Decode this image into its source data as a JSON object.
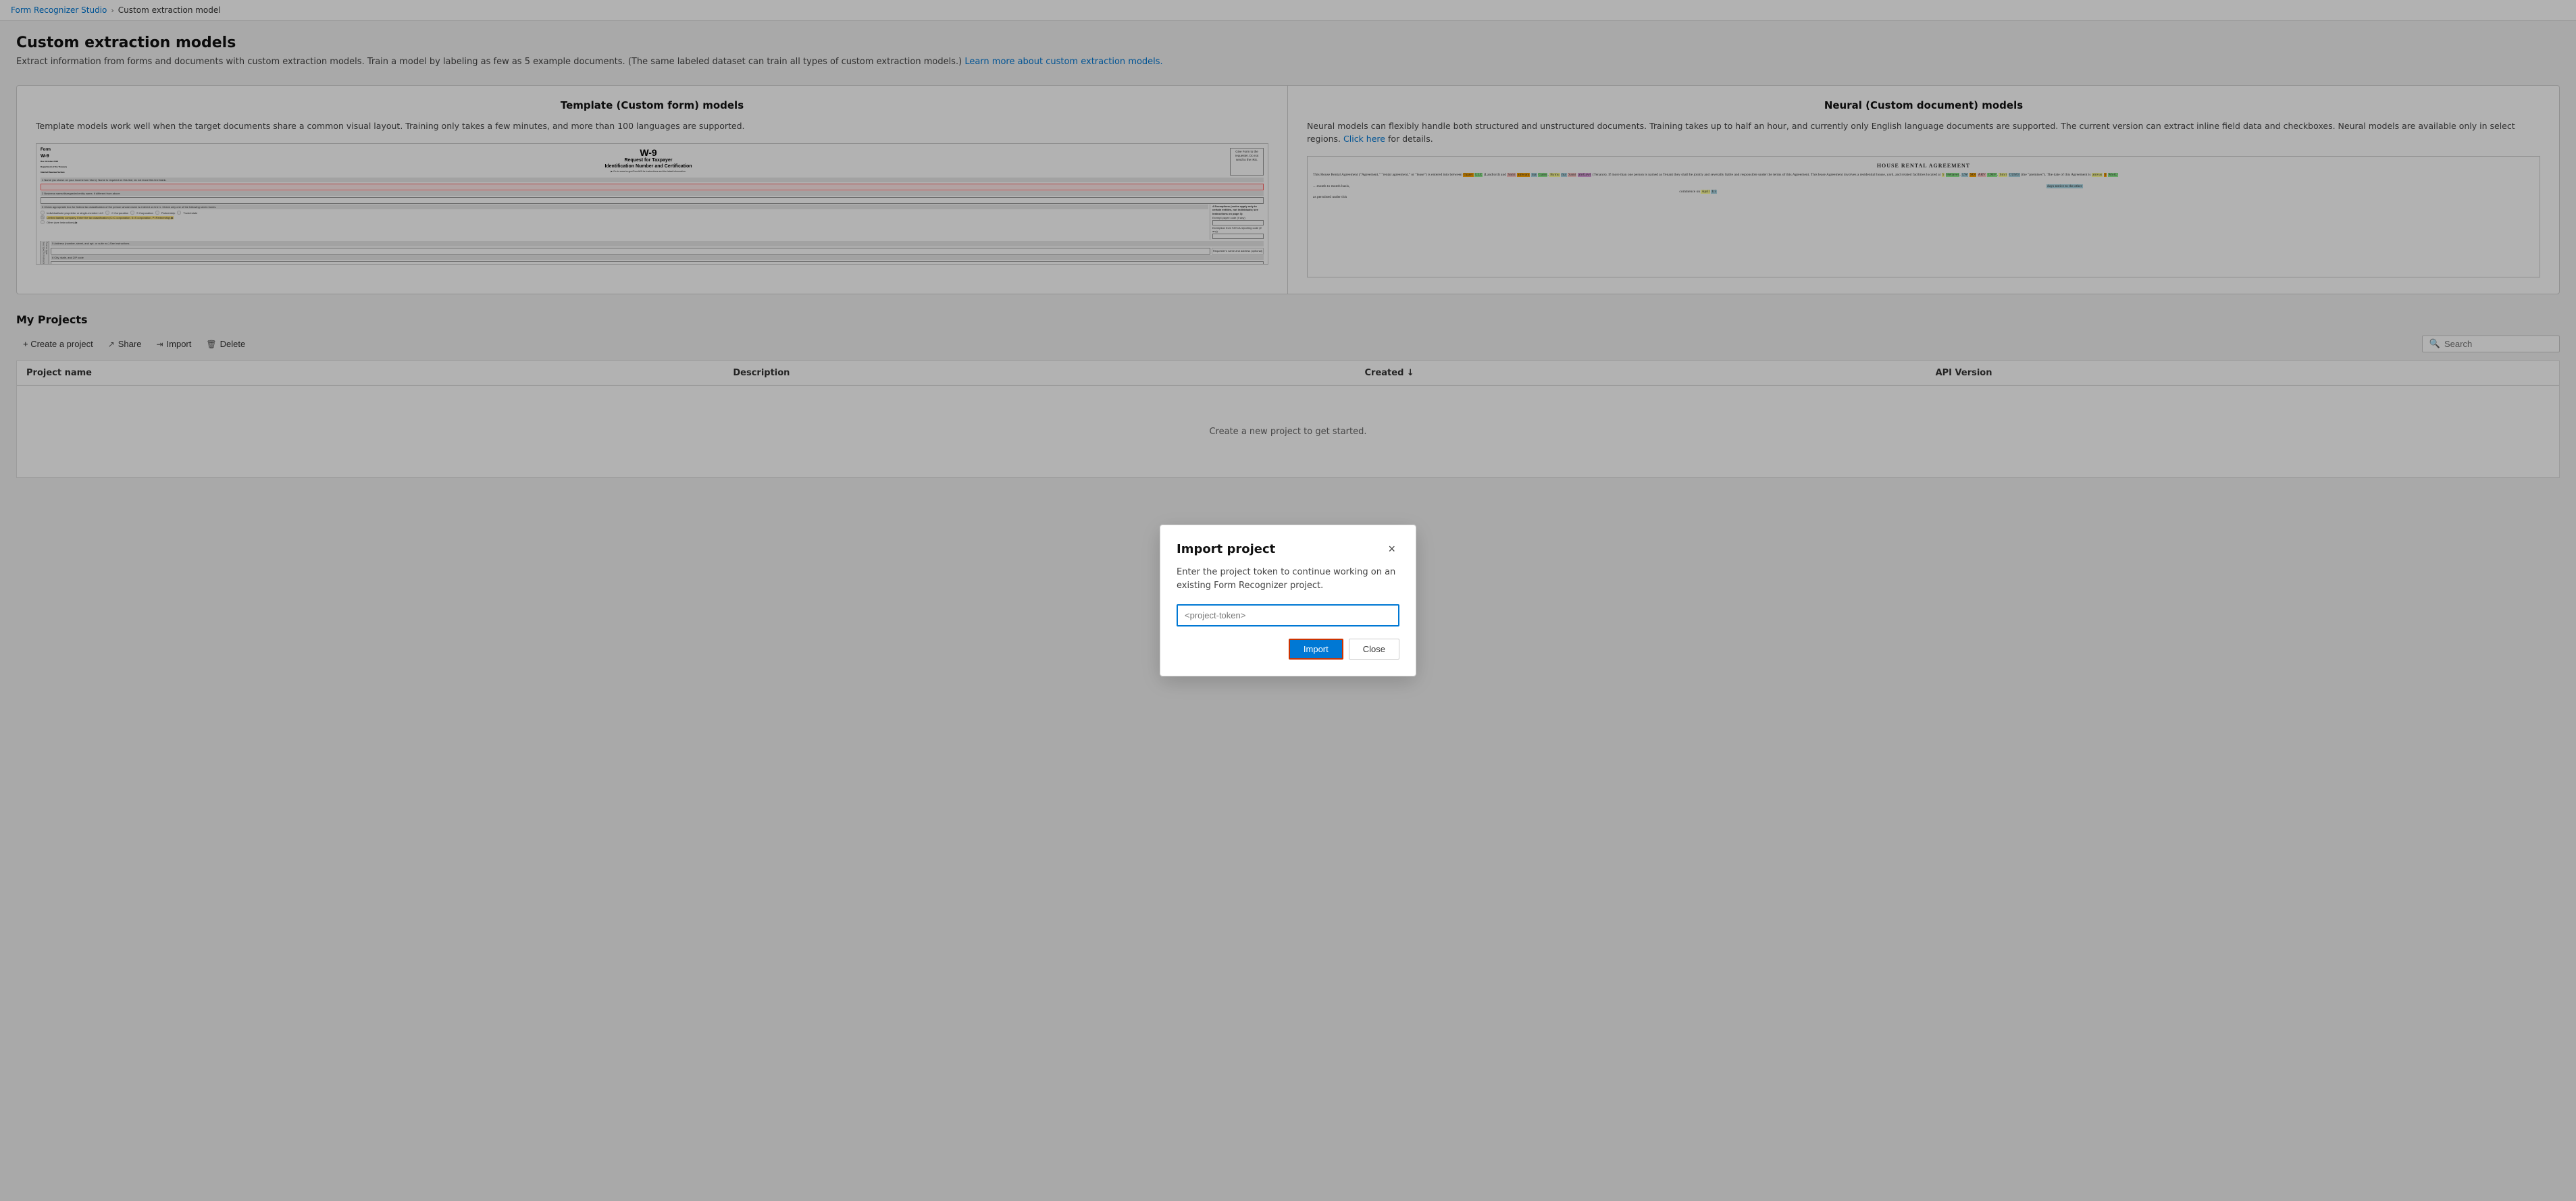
{
  "breadcrumb": {
    "parent_label": "Form Recognizer Studio",
    "separator": "›",
    "current_label": "Custom extraction model"
  },
  "page": {
    "title": "Custom extraction models",
    "description": "Extract information from forms and documents with custom extraction models. Train a model by labeling as few as 5 example documents. (The same labeled dataset can train all types of custom extraction models.)",
    "description_link": "Learn more about custom extraction models.",
    "description_link_url": "#"
  },
  "model_cards": [
    {
      "id": "template",
      "title": "Template (Custom form) models",
      "description": "Template models work well when the target documents share a common visual layout. Training only takes a few minutes, and more than 100 languages are supported."
    },
    {
      "id": "neural",
      "title": "Neural (Custom document) models",
      "description": "Neural models can flexibly handle both structured and unstructured documents. Training takes up to half an hour, and currently only English language documents are supported. The current version can extract inline field data and checkboxes. Neural models are available only in select regions.",
      "link_text": "Click here",
      "link_suffix": " for details."
    }
  ],
  "projects_section": {
    "title": "My Projects",
    "toolbar": {
      "create_label": "+ Create a project",
      "share_label": "Share",
      "import_label": "Import",
      "delete_label": "Delete"
    },
    "search": {
      "placeholder": "Search"
    },
    "table": {
      "columns": [
        {
          "id": "name",
          "label": "Project name"
        },
        {
          "id": "description",
          "label": "Description"
        },
        {
          "id": "created",
          "label": "Created ↓"
        },
        {
          "id": "api_version",
          "label": "API Version"
        }
      ],
      "rows": []
    },
    "empty_state": "Create a new project to get started."
  },
  "modal": {
    "title": "Import project",
    "description": "Enter the project token to continue working on an existing Form Recognizer project.",
    "input_placeholder": "<project-token>",
    "input_value": "<project-token>",
    "import_btn": "Import",
    "close_btn": "Close"
  }
}
